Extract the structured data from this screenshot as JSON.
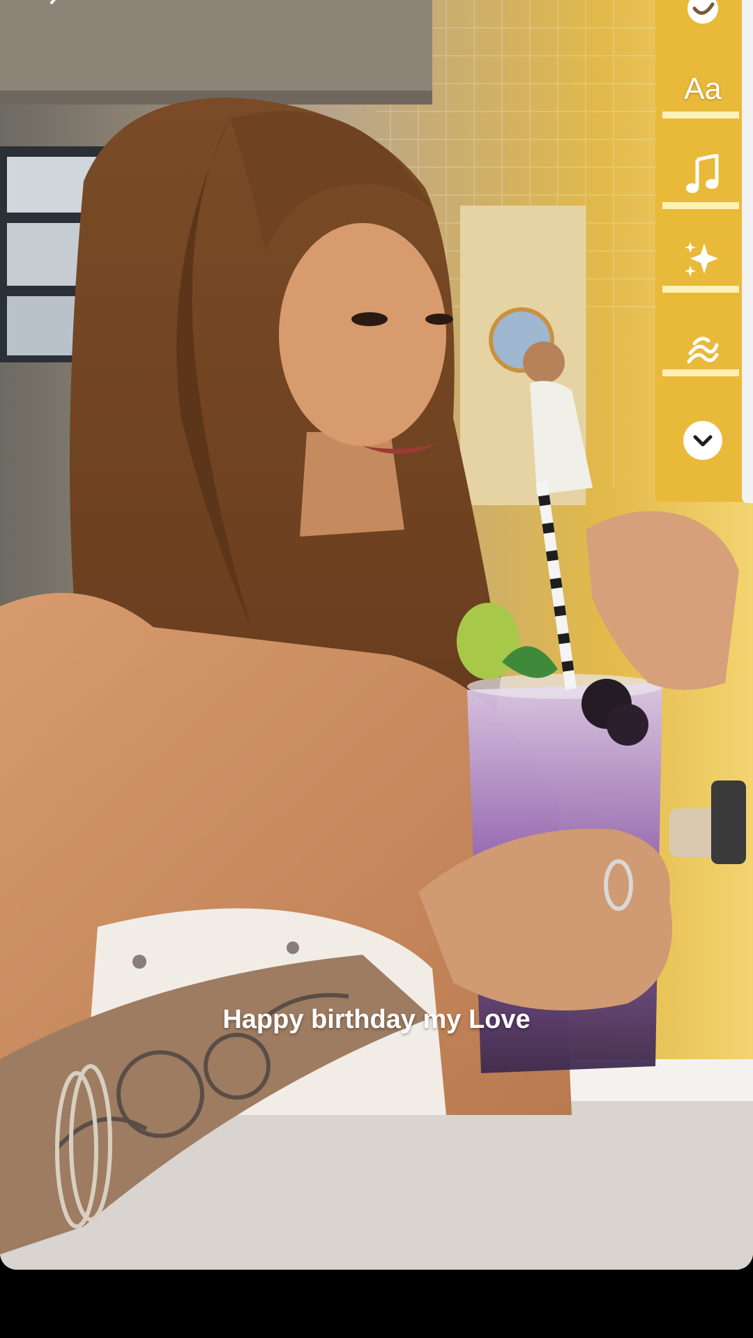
{
  "story": {
    "caption": "Happy birthday my Love"
  },
  "toolbar": {
    "text_tool_label": "Aa",
    "icons": [
      "sticker-icon",
      "text-icon",
      "music-icon",
      "effects-icon",
      "draw-icon",
      "chevron-down-icon"
    ]
  },
  "colors": {
    "background": "#000000",
    "caption": "#ffffff",
    "rail_strip": "#f2f2f2",
    "warm_light": "#f2c94c"
  }
}
